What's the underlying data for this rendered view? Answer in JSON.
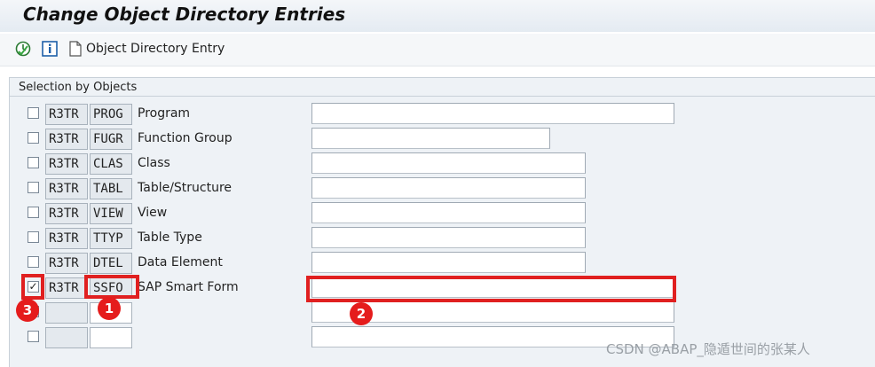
{
  "title": "Change Object Directory Entries",
  "toolbar": {
    "object_directory_entry_label": "Object Directory Entry"
  },
  "group": {
    "title": "Selection by Objects",
    "rows": [
      {
        "checked": false,
        "pgmid": "R3TR",
        "object": "PROG",
        "description": "Program",
        "value": ""
      },
      {
        "checked": false,
        "pgmid": "R3TR",
        "object": "FUGR",
        "description": "Function Group",
        "value": ""
      },
      {
        "checked": false,
        "pgmid": "R3TR",
        "object": "CLAS",
        "description": "Class",
        "value": ""
      },
      {
        "checked": false,
        "pgmid": "R3TR",
        "object": "TABL",
        "description": "Table/Structure",
        "value": ""
      },
      {
        "checked": false,
        "pgmid": "R3TR",
        "object": "VIEW",
        "description": "View",
        "value": ""
      },
      {
        "checked": false,
        "pgmid": "R3TR",
        "object": "TTYP",
        "description": "Table Type",
        "value": ""
      },
      {
        "checked": false,
        "pgmid": "R3TR",
        "object": "DTEL",
        "description": "Data Element",
        "value": ""
      },
      {
        "checked": true,
        "pgmid": "R3TR",
        "object": "SSFO",
        "description": "SAP Smart Form",
        "value": ""
      },
      {
        "checked": false,
        "pgmid": "",
        "object": "",
        "description": "",
        "value": ""
      },
      {
        "checked": false,
        "pgmid": "",
        "object": "",
        "description": "",
        "value": ""
      }
    ]
  },
  "annotations": {
    "marker_1": "1",
    "marker_2": "2",
    "marker_3": "3",
    "color": "#e51c1c"
  },
  "watermark": "CSDN @ABAP_隐遁世间的张某人",
  "icons": {
    "execute": "execute-clock-icon",
    "info": "info-icon",
    "document": "document-icon"
  }
}
